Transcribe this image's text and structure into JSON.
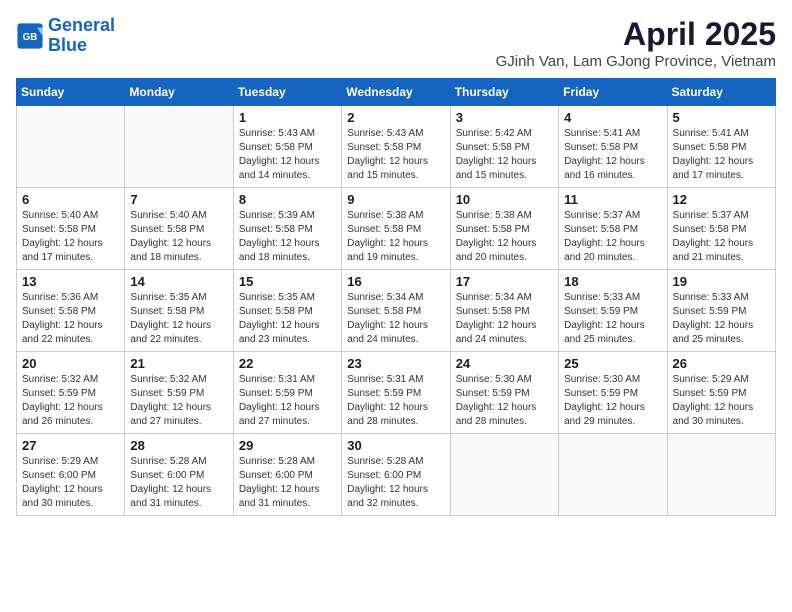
{
  "header": {
    "logo_line1": "General",
    "logo_line2": "Blue",
    "title": "April 2025",
    "subtitle": "GJinh Van, Lam GJong Province, Vietnam"
  },
  "calendar": {
    "days_of_week": [
      "Sunday",
      "Monday",
      "Tuesday",
      "Wednesday",
      "Thursday",
      "Friday",
      "Saturday"
    ],
    "weeks": [
      [
        {
          "day": "",
          "info": ""
        },
        {
          "day": "",
          "info": ""
        },
        {
          "day": "1",
          "info": "Sunrise: 5:43 AM\nSunset: 5:58 PM\nDaylight: 12 hours\nand 14 minutes."
        },
        {
          "day": "2",
          "info": "Sunrise: 5:43 AM\nSunset: 5:58 PM\nDaylight: 12 hours\nand 15 minutes."
        },
        {
          "day": "3",
          "info": "Sunrise: 5:42 AM\nSunset: 5:58 PM\nDaylight: 12 hours\nand 15 minutes."
        },
        {
          "day": "4",
          "info": "Sunrise: 5:41 AM\nSunset: 5:58 PM\nDaylight: 12 hours\nand 16 minutes."
        },
        {
          "day": "5",
          "info": "Sunrise: 5:41 AM\nSunset: 5:58 PM\nDaylight: 12 hours\nand 17 minutes."
        }
      ],
      [
        {
          "day": "6",
          "info": "Sunrise: 5:40 AM\nSunset: 5:58 PM\nDaylight: 12 hours\nand 17 minutes."
        },
        {
          "day": "7",
          "info": "Sunrise: 5:40 AM\nSunset: 5:58 PM\nDaylight: 12 hours\nand 18 minutes."
        },
        {
          "day": "8",
          "info": "Sunrise: 5:39 AM\nSunset: 5:58 PM\nDaylight: 12 hours\nand 18 minutes."
        },
        {
          "day": "9",
          "info": "Sunrise: 5:38 AM\nSunset: 5:58 PM\nDaylight: 12 hours\nand 19 minutes."
        },
        {
          "day": "10",
          "info": "Sunrise: 5:38 AM\nSunset: 5:58 PM\nDaylight: 12 hours\nand 20 minutes."
        },
        {
          "day": "11",
          "info": "Sunrise: 5:37 AM\nSunset: 5:58 PM\nDaylight: 12 hours\nand 20 minutes."
        },
        {
          "day": "12",
          "info": "Sunrise: 5:37 AM\nSunset: 5:58 PM\nDaylight: 12 hours\nand 21 minutes."
        }
      ],
      [
        {
          "day": "13",
          "info": "Sunrise: 5:36 AM\nSunset: 5:58 PM\nDaylight: 12 hours\nand 22 minutes."
        },
        {
          "day": "14",
          "info": "Sunrise: 5:35 AM\nSunset: 5:58 PM\nDaylight: 12 hours\nand 22 minutes."
        },
        {
          "day": "15",
          "info": "Sunrise: 5:35 AM\nSunset: 5:58 PM\nDaylight: 12 hours\nand 23 minutes."
        },
        {
          "day": "16",
          "info": "Sunrise: 5:34 AM\nSunset: 5:58 PM\nDaylight: 12 hours\nand 24 minutes."
        },
        {
          "day": "17",
          "info": "Sunrise: 5:34 AM\nSunset: 5:58 PM\nDaylight: 12 hours\nand 24 minutes."
        },
        {
          "day": "18",
          "info": "Sunrise: 5:33 AM\nSunset: 5:59 PM\nDaylight: 12 hours\nand 25 minutes."
        },
        {
          "day": "19",
          "info": "Sunrise: 5:33 AM\nSunset: 5:59 PM\nDaylight: 12 hours\nand 25 minutes."
        }
      ],
      [
        {
          "day": "20",
          "info": "Sunrise: 5:32 AM\nSunset: 5:59 PM\nDaylight: 12 hours\nand 26 minutes."
        },
        {
          "day": "21",
          "info": "Sunrise: 5:32 AM\nSunset: 5:59 PM\nDaylight: 12 hours\nand 27 minutes."
        },
        {
          "day": "22",
          "info": "Sunrise: 5:31 AM\nSunset: 5:59 PM\nDaylight: 12 hours\nand 27 minutes."
        },
        {
          "day": "23",
          "info": "Sunrise: 5:31 AM\nSunset: 5:59 PM\nDaylight: 12 hours\nand 28 minutes."
        },
        {
          "day": "24",
          "info": "Sunrise: 5:30 AM\nSunset: 5:59 PM\nDaylight: 12 hours\nand 28 minutes."
        },
        {
          "day": "25",
          "info": "Sunrise: 5:30 AM\nSunset: 5:59 PM\nDaylight: 12 hours\nand 29 minutes."
        },
        {
          "day": "26",
          "info": "Sunrise: 5:29 AM\nSunset: 5:59 PM\nDaylight: 12 hours\nand 30 minutes."
        }
      ],
      [
        {
          "day": "27",
          "info": "Sunrise: 5:29 AM\nSunset: 6:00 PM\nDaylight: 12 hours\nand 30 minutes."
        },
        {
          "day": "28",
          "info": "Sunrise: 5:28 AM\nSunset: 6:00 PM\nDaylight: 12 hours\nand 31 minutes."
        },
        {
          "day": "29",
          "info": "Sunrise: 5:28 AM\nSunset: 6:00 PM\nDaylight: 12 hours\nand 31 minutes."
        },
        {
          "day": "30",
          "info": "Sunrise: 5:28 AM\nSunset: 6:00 PM\nDaylight: 12 hours\nand 32 minutes."
        },
        {
          "day": "",
          "info": ""
        },
        {
          "day": "",
          "info": ""
        },
        {
          "day": "",
          "info": ""
        }
      ]
    ]
  }
}
